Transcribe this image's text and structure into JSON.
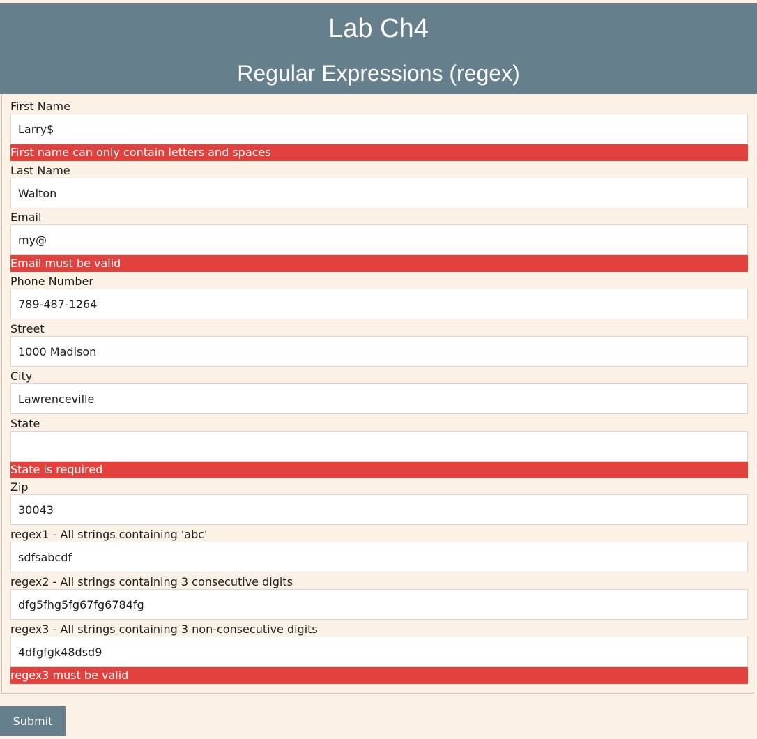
{
  "header": {
    "title": "Lab Ch4",
    "subtitle": "Regular Expressions (regex)"
  },
  "form": {
    "fields": [
      {
        "label": "First Name",
        "value": "Larry$",
        "error": "First name can only contain letters and spaces"
      },
      {
        "label": "Last Name",
        "value": "Walton"
      },
      {
        "label": "Email",
        "value": "my@",
        "error": "Email must be valid"
      },
      {
        "label": "Phone Number",
        "value": "789-487-1264"
      },
      {
        "label": "Street",
        "value": "1000 Madison"
      },
      {
        "label": "City",
        "value": "Lawrenceville"
      },
      {
        "label": "State",
        "value": "",
        "error": "State is required"
      },
      {
        "label": "Zip",
        "value": "30043"
      },
      {
        "label": "regex1 - All strings containing 'abc'",
        "value": "sdfsabcdf"
      },
      {
        "label": "regex2 - All strings containing 3 consecutive digits",
        "value": "dfg5fhg5fg67fg6784fg"
      },
      {
        "label": "regex3 - All strings containing 3 non-consecutive digits",
        "value": "4dfgfgk48dsd9",
        "error": "regex3 must be valid"
      }
    ],
    "submit_label": "Submit"
  },
  "colors": {
    "header_bg": "#667f8c",
    "page_bg": "#fcf1e5",
    "error_bg": "#e2413e",
    "button_bg": "#667f8c"
  }
}
